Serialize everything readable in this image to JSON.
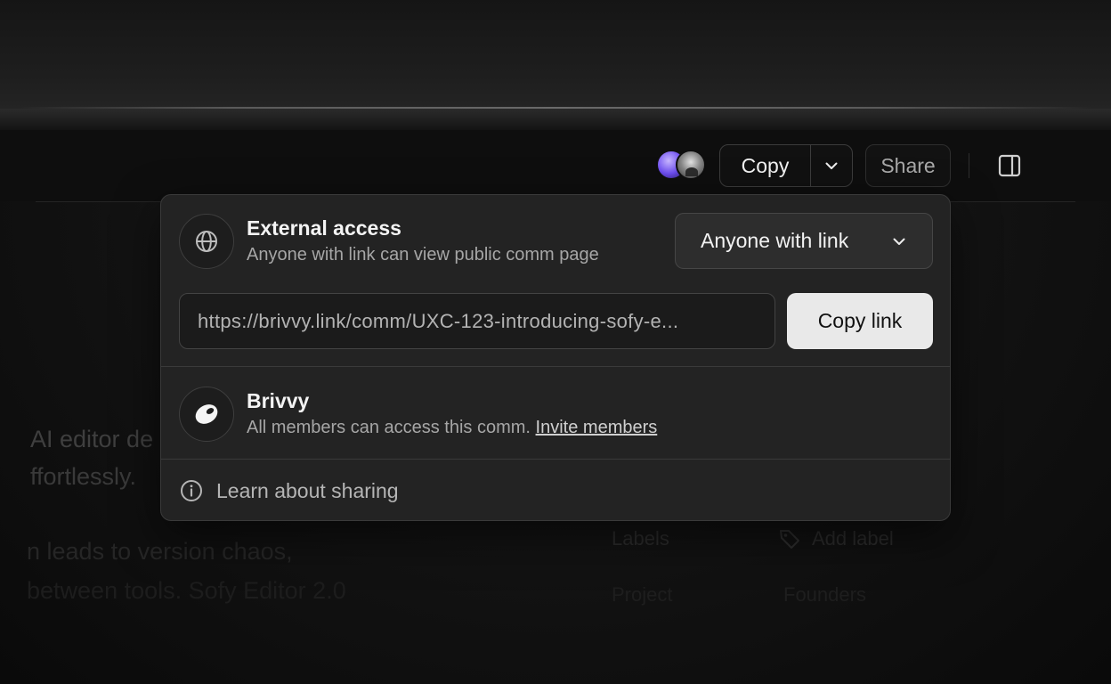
{
  "toolbar": {
    "copy_label": "Copy",
    "share_label": "Share"
  },
  "background": {
    "line1": "AI editor de",
    "line2": "ffortlessly.",
    "line3": "n leads to version chaos,",
    "line4": "between tools. Sofy Editor 2.0",
    "labels_label": "Labels",
    "add_label": "Add label",
    "meta_left": "Project",
    "meta_right": "Founders"
  },
  "share_popover": {
    "external": {
      "title": "External access",
      "subtitle": "Anyone with link can view public comm page",
      "access_level": "Anyone with link",
      "link_url": "https://brivvy.link/comm/UXC-123-introducing-sofy-e...",
      "copy_link_label": "Copy link"
    },
    "org": {
      "title": "Brivvy",
      "subtitle": "All members can access this comm.",
      "invite_label": "Invite members"
    },
    "learn_label": "Learn about sharing"
  },
  "colors": {
    "popover_bg": "#232323",
    "primary_button_bg": "#e9e9e9",
    "avatar_accent": "#6c4cf0"
  }
}
